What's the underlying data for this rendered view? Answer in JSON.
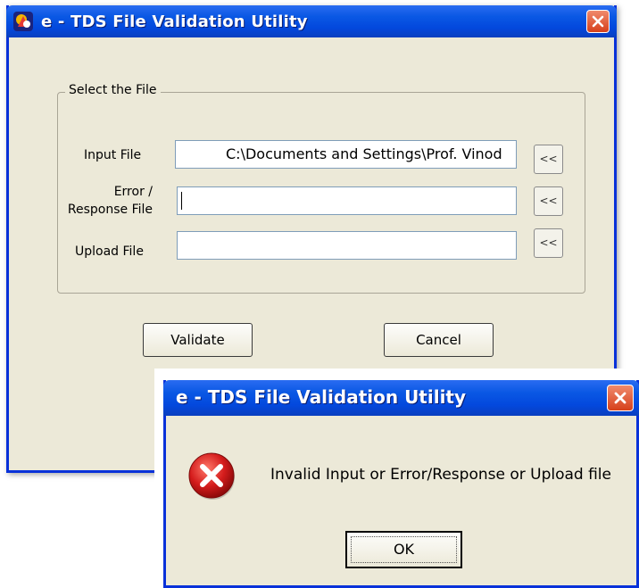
{
  "main_window": {
    "title": "e - TDS File  Validation Utility",
    "group_label": "Select the File",
    "input_file_label": "Input File",
    "input_file_value": "C:\\Documents and Settings\\Prof. Vinod",
    "error_label_line1": "Error /",
    "error_label_line2": "Response File",
    "error_file_value": "",
    "upload_file_label": "Upload File",
    "upload_file_value": "",
    "browse_label": "<<",
    "validate_label": "Validate",
    "cancel_label": "Cancel"
  },
  "dialog": {
    "title": "e - TDS File  Validation Utility",
    "message": "Invalid Input or Error/Response or Upload file",
    "ok_label": "OK"
  },
  "colors": {
    "titlebar": "#0a58e4",
    "window_bg": "#ece9d8",
    "close_red": "#d6401b",
    "error_red": "#d41c1c"
  }
}
